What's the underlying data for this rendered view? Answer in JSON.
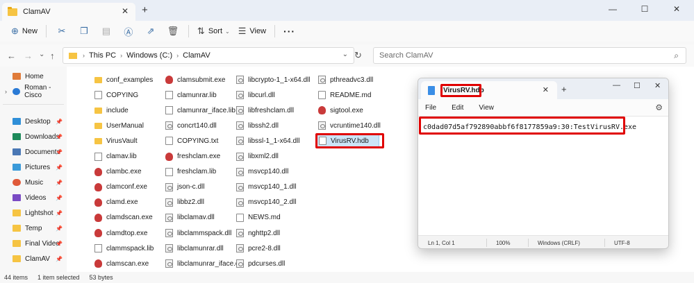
{
  "explorer": {
    "tab_title": "ClamAV",
    "commands": {
      "new": "New",
      "sort": "Sort",
      "view": "View"
    },
    "breadcrumb": [
      "This PC",
      "Windows (C:)",
      "ClamAV"
    ],
    "search_placeholder": "Search ClamAV",
    "sidebar": {
      "home": "Home",
      "user": "Roman - Cisco",
      "quick": [
        "Desktop",
        "Downloads",
        "Documents",
        "Pictures",
        "Music",
        "Videos",
        "Lightshot",
        "Temp",
        "Final Video",
        "ClamAV"
      ]
    },
    "files": {
      "col1": [
        "conf_examples",
        "COPYING",
        "include",
        "UserManual",
        "VirusVault",
        "clamav.lib",
        "clambc.exe",
        "clamconf.exe",
        "clamd.exe",
        "clamdscan.exe",
        "clamdtop.exe",
        "clammspack.lib",
        "clamscan.exe"
      ],
      "col2": [
        "clamsubmit.exe",
        "clamunrar.lib",
        "clamunrar_iface.lib",
        "concrt140.dll",
        "COPYING.txt",
        "freshclam.exe",
        "freshclam.lib",
        "json-c.dll",
        "libbz2.dll",
        "libclamav.dll",
        "libclammspack.dll",
        "libclamunrar.dll",
        "libclamunrar_iface.dll"
      ],
      "col3": [
        "libcrypto-1_1-x64.dll",
        "libcurl.dll",
        "libfreshclam.dll",
        "libssh2.dll",
        "libssl-1_1-x64.dll",
        "libxml2.dll",
        "msvcp140.dll",
        "msvcp140_1.dll",
        "msvcp140_2.dll",
        "NEWS.md",
        "nghttp2.dll",
        "pcre2-8.dll",
        "pdcurses.dll"
      ],
      "col4": [
        "pthreadvc3.dll",
        "README.md",
        "sigtool.exe",
        "vcruntime140.dll",
        "VirusRV.hdb"
      ]
    },
    "status": {
      "items": "44 items",
      "selected": "1 item selected",
      "size": "53 bytes"
    }
  },
  "notepad": {
    "tab_title": "VirusRV.hdb",
    "menu": [
      "File",
      "Edit",
      "View"
    ],
    "content": "c0dad07d5af792890abbf6f8177859a9:30:TestVirusRV.exe",
    "status": {
      "position": "Ln 1, Col 1",
      "zoom": "100%",
      "line_ending": "Windows (CRLF)",
      "encoding": "UTF-8"
    }
  }
}
